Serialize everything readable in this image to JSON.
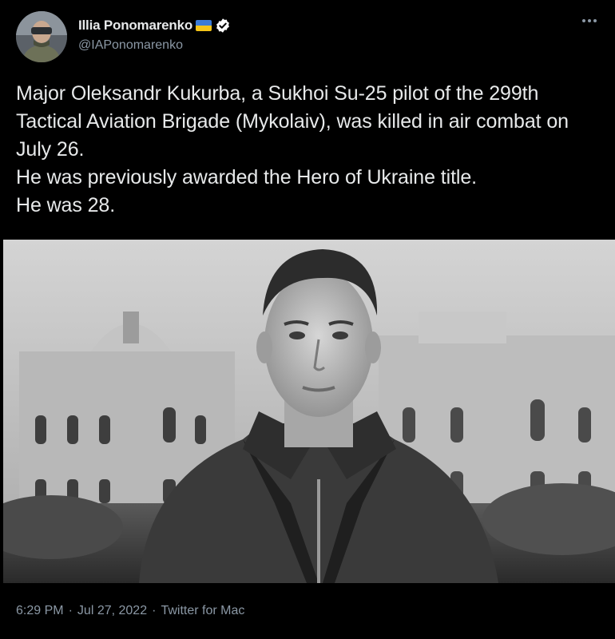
{
  "author": {
    "display_name": "Illia Ponomarenko",
    "handle": "@IAPonomarenko",
    "flag_icon": "ukraine-flag-icon",
    "verified_icon": "verified-badge-icon"
  },
  "more_icon": "more-horizontal-icon",
  "tweet": {
    "lines": [
      "Major Oleksandr Kukurba, a Sukhoi Su-25 pilot of the 299th Tactical Aviation Brigade (Mykolaiv), was killed in air combat on July 26.",
      "He was previously awarded the Hero of Ukraine title.",
      "He was 28."
    ]
  },
  "media": {
    "type": "photo",
    "style": "black-and-white"
  },
  "meta": {
    "time": "6:29 PM",
    "separator": "·",
    "date": "Jul 27, 2022",
    "source": "Twitter for Mac"
  },
  "colors": {
    "background": "#000000",
    "text": "#e7e9ea",
    "secondary": "#8b98a5",
    "flag_blue": "#3b7bd6",
    "flag_yellow": "#f5c518"
  }
}
